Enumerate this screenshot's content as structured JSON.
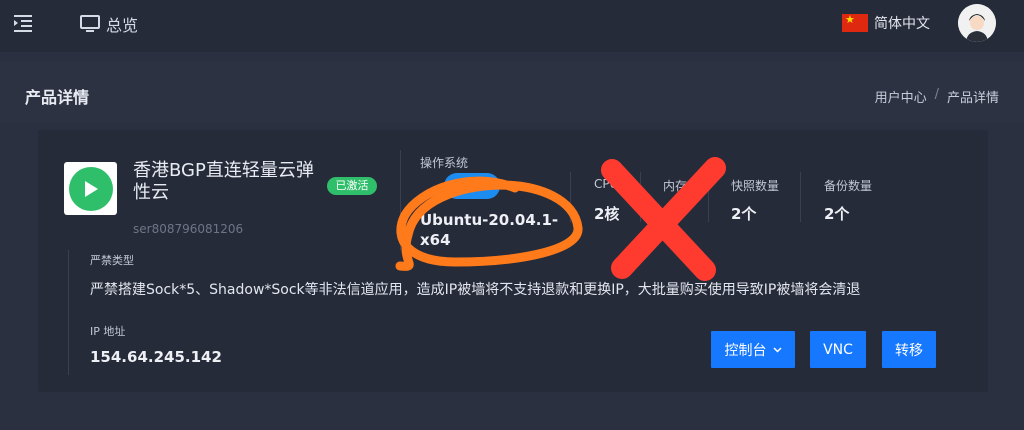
{
  "header": {
    "menu_icon": "menu-indent-icon",
    "nav_overview_icon": "monitor-icon",
    "nav_overview_label": "总览",
    "language_label": "简体中文",
    "flag_icon": "china-flag-icon",
    "avatar_icon": "user-avatar"
  },
  "page": {
    "title": "产品详情",
    "breadcrumb": [
      "用户中心",
      "产品详情"
    ]
  },
  "product": {
    "name": "香港BGP直连轻量云弹性云",
    "status_badge": "已激活",
    "serial": "ser808796081206",
    "os_label": "操作系统",
    "os_value": "Ubuntu-20.04.1-x64",
    "stats": [
      {
        "label": "CPU",
        "value": "2核"
      },
      {
        "label": "内存",
        "value": ""
      },
      {
        "label": "快照数量",
        "value": "2个"
      },
      {
        "label": "备份数量",
        "value": "2个"
      }
    ],
    "ban_label": "严禁类型",
    "ban_text": "严禁搭建Sock*5、Shadow*Sock等非法信道应用，造成IP被墙将不支持退款和更换IP，大批量购买使用导致IP被墙将会清退",
    "ip_label": "IP 地址",
    "ip_value": "154.64.245.142"
  },
  "actions": {
    "console_label": "控制台",
    "vnc_label": "VNC",
    "transfer_label": "转移"
  },
  "colors": {
    "accent": "#1677ff",
    "active_badge": "#2fbe6a",
    "annotation_orange": "#ff7a1a",
    "annotation_red": "#ff3b30"
  }
}
